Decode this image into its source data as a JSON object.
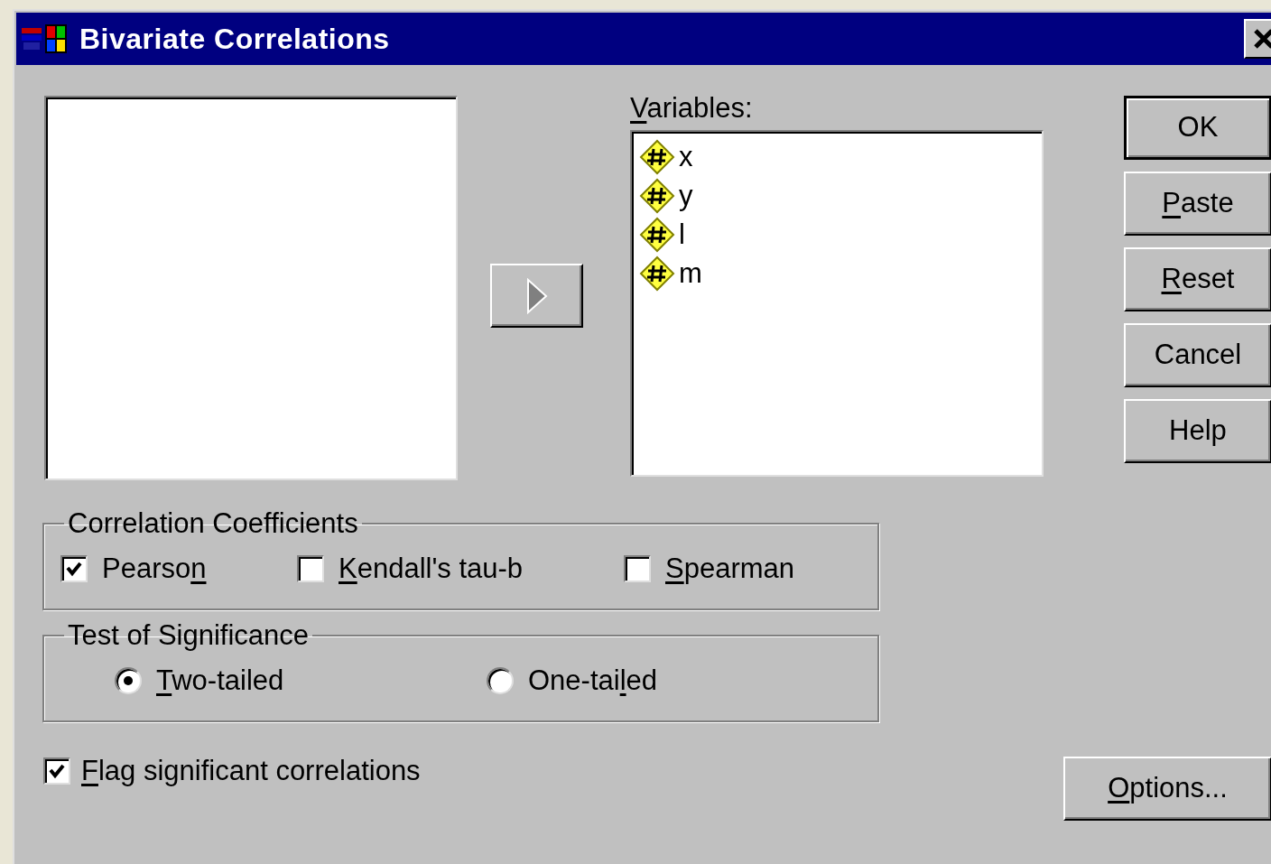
{
  "window": {
    "title": "Bivariate Correlations"
  },
  "move_button": {
    "disabled": true
  },
  "variables": {
    "label": [
      {
        "text": "V",
        "underline": true
      },
      {
        "text": "ariables:",
        "underline": false
      }
    ],
    "items": [
      {
        "name": "x"
      },
      {
        "name": "y"
      },
      {
        "name": "l"
      },
      {
        "name": "m"
      }
    ]
  },
  "buttons": [
    {
      "label": [
        {
          "text": "OK",
          "underline": false
        }
      ],
      "default": true
    },
    {
      "label": [
        {
          "text": "P",
          "underline": true
        },
        {
          "text": "aste",
          "underline": false
        }
      ],
      "default": false
    },
    {
      "label": [
        {
          "text": "R",
          "underline": true
        },
        {
          "text": "eset",
          "underline": false
        }
      ],
      "default": false
    },
    {
      "label": [
        {
          "text": "Cancel",
          "underline": false
        }
      ],
      "default": false
    },
    {
      "label": [
        {
          "text": "Help",
          "underline": false
        }
      ],
      "default": false
    }
  ],
  "correlation_coefficients": {
    "title": "Correlation Coefficients",
    "options": [
      {
        "label": [
          {
            "text": "Pearso",
            "underline": false
          },
          {
            "text": "n",
            "underline": true
          }
        ],
        "checked": true
      },
      {
        "label": [
          {
            "text": "K",
            "underline": true
          },
          {
            "text": "endall's tau-b",
            "underline": false
          }
        ],
        "checked": false
      },
      {
        "label": [
          {
            "text": "S",
            "underline": true
          },
          {
            "text": "pearman",
            "underline": false
          }
        ],
        "checked": false
      }
    ]
  },
  "test_of_significance": {
    "title": "Test of Significance",
    "options": [
      {
        "label": [
          {
            "text": "T",
            "underline": true
          },
          {
            "text": "wo-tailed",
            "underline": false
          }
        ],
        "selected": true
      },
      {
        "label": [
          {
            "text": "One-tai",
            "underline": false
          },
          {
            "text": "l",
            "underline": true
          },
          {
            "text": "ed",
            "underline": false
          }
        ],
        "selected": false
      }
    ]
  },
  "flag_significant": {
    "label": [
      {
        "text": "F",
        "underline": true
      },
      {
        "text": "lag significant correlations",
        "underline": false
      }
    ],
    "checked": true
  },
  "options_button": {
    "label": [
      {
        "text": "O",
        "underline": true
      },
      {
        "text": "ptions...",
        "underline": false
      }
    ]
  }
}
